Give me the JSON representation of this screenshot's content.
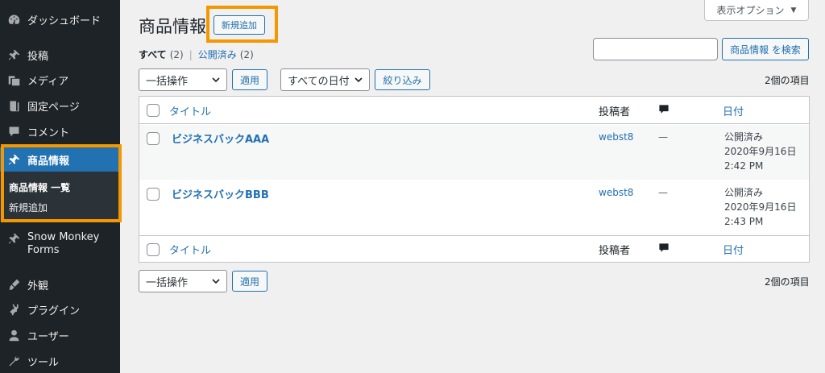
{
  "sidebar": {
    "items": [
      {
        "label": "ダッシュボード",
        "icon": "dashboard-icon"
      },
      {
        "label": "投稿",
        "icon": "pin-icon"
      },
      {
        "label": "メディア",
        "icon": "media-icon"
      },
      {
        "label": "固定ページ",
        "icon": "page-icon"
      },
      {
        "label": "コメント",
        "icon": "comment-icon"
      },
      {
        "label": "商品情報",
        "icon": "pin-icon"
      },
      {
        "label": "Snow Monkey",
        "label2": "Forms",
        "icon": "pin-icon"
      },
      {
        "label": "外観",
        "icon": "appearance-icon"
      },
      {
        "label": "プラグイン",
        "icon": "plugin-icon"
      },
      {
        "label": "ユーザー",
        "icon": "user-icon"
      },
      {
        "label": "ツール",
        "icon": "tool-icon"
      }
    ],
    "submenu": {
      "list": "商品情報 一覧",
      "add_new": "新規追加"
    }
  },
  "header": {
    "title": "商品情報",
    "add_new": "新規追加",
    "screen_options": "表示オプション"
  },
  "filters": {
    "all_label": "すべて",
    "all_count": "(2)",
    "published_label": "公開済み",
    "published_count": "(2)"
  },
  "search": {
    "button": "商品情報 を検索",
    "placeholder": ""
  },
  "toolbar": {
    "bulk_action": "一括操作",
    "apply": "適用",
    "date_filter": "すべての日付",
    "filter_button": "絞り込み",
    "item_count": "2個の項目"
  },
  "table": {
    "columns": {
      "title": "タイトル",
      "author": "投稿者",
      "date": "日付"
    },
    "rows": [
      {
        "title": "ビジネスバックAAA",
        "author": "webst8",
        "comments": "—",
        "status": "公開済み",
        "date": "2020年9月16日",
        "time": "2:42 PM"
      },
      {
        "title": "ビジネスバックBBB",
        "author": "webst8",
        "comments": "—",
        "status": "公開済み",
        "date": "2020年9月16日",
        "time": "2:43 PM"
      }
    ]
  },
  "colors": {
    "accent": "#2271b1",
    "highlight": "#f39800",
    "sidebar_bg": "#1d2327"
  }
}
